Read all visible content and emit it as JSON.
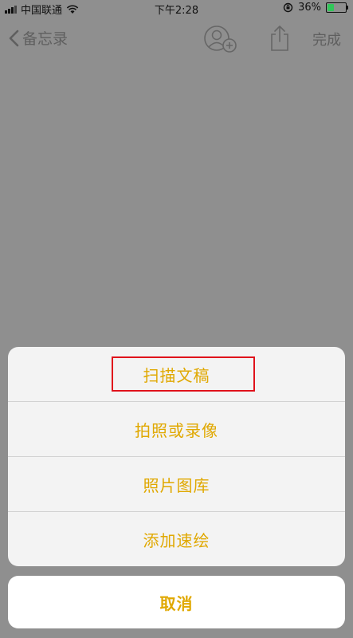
{
  "status_bar": {
    "carrier": "中国联通",
    "time": "下午2:28",
    "battery_percent": "36%",
    "battery_level": 0.36
  },
  "nav_bar": {
    "back_label": "备忘录",
    "done_label": "完成",
    "icons": [
      "person-add-icon",
      "share-icon"
    ]
  },
  "action_sheet": {
    "items": [
      {
        "label": "扫描文稿",
        "highlighted": true
      },
      {
        "label": "拍照或录像"
      },
      {
        "label": "照片图库"
      },
      {
        "label": "添加速绘"
      }
    ],
    "cancel_label": "取消"
  },
  "colors": {
    "accent": "#e0a800",
    "highlight_border": "#e0121b",
    "overlay": "#8f8f8f"
  }
}
